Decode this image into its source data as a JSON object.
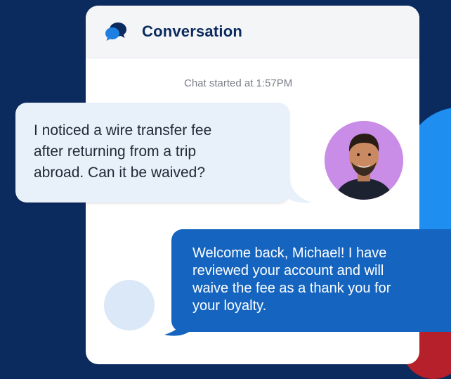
{
  "header": {
    "title": "Conversation",
    "icon": "chat-bubbles-icon"
  },
  "chat": {
    "started_label": "Chat started at 1:57PM",
    "messages": [
      {
        "from": "customer",
        "text": "I noticed a wire transfer fee\nafter returning from a trip\nabroad. Can it be waived?"
      },
      {
        "from": "agent",
        "text": "Welcome back, Michael! I have\nreviewed your account and will\nwaive the fee as a thank you for\nyour loyalty."
      }
    ]
  },
  "colors": {
    "background": "#0b2a5e",
    "agent_bubble": "#1565c0",
    "customer_bubble": "#e8f0f9",
    "avatar_bg": "#c98de8",
    "title_color": "#0b2a5e"
  }
}
